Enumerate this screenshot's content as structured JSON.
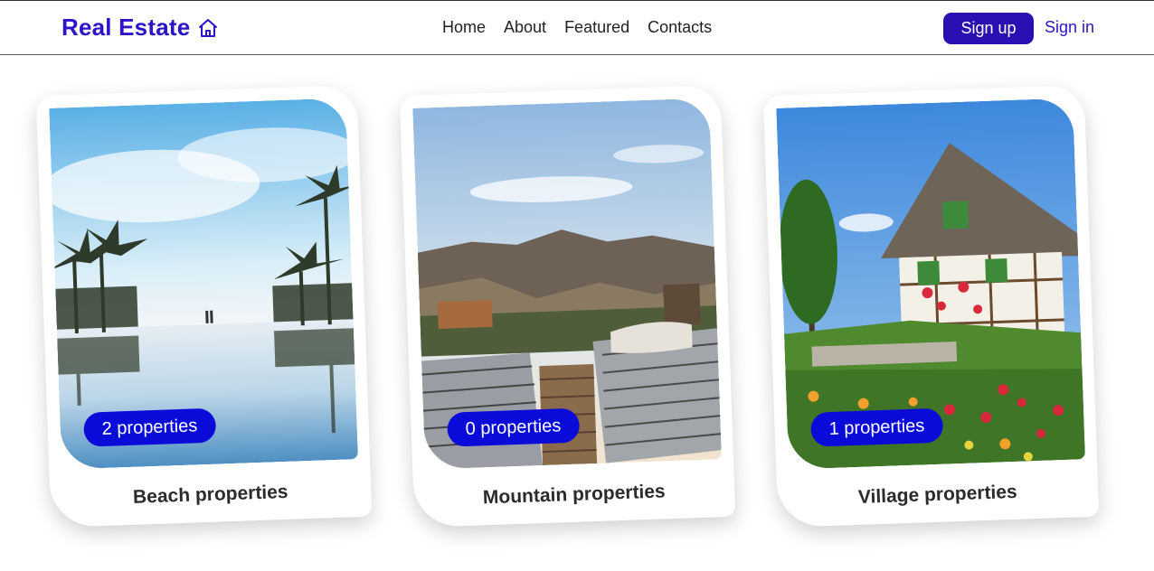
{
  "navbar": {
    "brand": "Real Estate",
    "brand_icon": "home-icon",
    "links": [
      "Home",
      "About",
      "Featured",
      "Contacts"
    ],
    "signup_label": "Sign up",
    "signin_label": "Sign in",
    "colors": {
      "brand": "#2a13c9",
      "signup_bg": "#2a0fb3",
      "badge_bg": "#0b0bd9"
    }
  },
  "cards": [
    {
      "title": "Beach properties",
      "badge": "2 properties",
      "image": "beach-photo"
    },
    {
      "title": "Mountain properties",
      "badge": "0 properties",
      "image": "mountain-photo"
    },
    {
      "title": "Village properties",
      "badge": "1 properties",
      "image": "village-photo"
    }
  ]
}
